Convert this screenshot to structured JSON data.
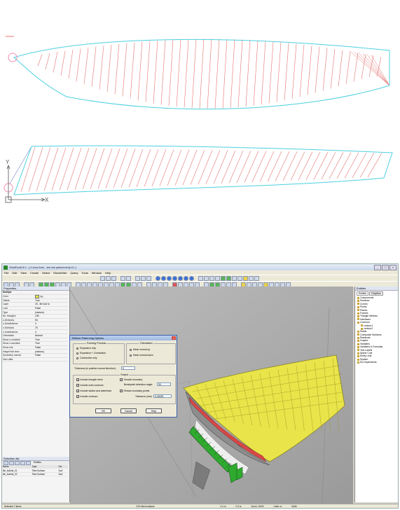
{
  "axes": {
    "y_label": "Y",
    "x_label": "X"
  },
  "app": {
    "title": "ShelfDraft 8.0 - [ Z-bow.3dm - tee tab pattern/ship:01 ]",
    "window_buttons": [
      "_",
      "□",
      "×"
    ],
    "menu": [
      "File",
      "Edit",
      "View",
      "Create",
      "Select",
      "Show/Hide",
      "Query",
      "Tools",
      "Window",
      "Help"
    ],
    "left_panel_title": "Properties",
    "properties": [
      [
        "Multiple",
        ""
      ],
      [
        "Color",
        "Yel"
      ],
      [
        "Visible",
        "True"
      ],
      [
        "Layer",
        "25 - tile tool to"
      ],
      [
        "Lock",
        "False"
      ],
      [
        "Type",
        "(various)"
      ],
      [
        "No. triangles",
        "136"
      ],
      [
        "u-Divisions",
        "54"
      ],
      [
        "u-Subdivisions",
        "4"
      ],
      [
        "v-Divisions",
        "76"
      ],
      [
        "v-Subdivisions",
        "4"
      ],
      [
        "Orientation",
        "Normal"
      ],
      [
        "Show u-constant",
        "True"
      ],
      [
        "Show v-constant",
        "True"
      ],
      [
        "Show rule",
        "False"
      ],
      [
        "Insight fold view",
        "(various)"
      ],
      [
        "Symmetry normal",
        "False"
      ],
      [
        "User data",
        ""
      ]
    ],
    "selection_title": "Selection list",
    "selection_tab": "Entities",
    "selection_columns": [
      "Name",
      "Type",
      "Ow"
    ],
    "selection_rows": [
      [
        "tile_bulkhd_01",
        "Tiled Surface",
        "Surf"
      ],
      [
        "tile_bulkhd_02",
        "Tiled Surface",
        "Surf"
      ]
    ],
    "right_tabs": [
      "Entities",
      "Graphics"
    ],
    "tree": [
      "Components",
      "Surfaces",
      "Curves",
      "Points",
      "Planes",
      "Frames",
      "Triangle Meshes",
      "Interfaces",
      "Contours",
      "contour1",
      "contour2",
      "Solids",
      "Composite Surfaces",
      "Readouts",
      "Graphs",
      "Variables",
      "Variables & Formulas",
      "Text Labels",
      "Spline Cuts",
      "Entity Lists",
      "System",
      "No Dependents"
    ],
    "status": [
      "Selected: 2 items",
      "21%  tiled surfaces",
      "0.4 m",
      "0.3 m",
      "Zoom: 100%",
      "Units: m",
      "NUM"
    ],
    "colors": {
      "accent": "#3a6fd8",
      "surface_yellow": "#e8e44a",
      "stiffener_green": "#2faa2f",
      "rule_red": "#e04444"
    }
  },
  "dialog": {
    "title": "TriMesh Patterning Options",
    "close": "×",
    "forming_title": "Forming Process",
    "forming_options": [
      "Expansion only",
      "Expansion + Contraction",
      "Contraction only"
    ],
    "forming_selected": 1,
    "orientation_title": "Orientation",
    "orientation_options": [
      "Mesh normal up",
      "Mesh normal down"
    ],
    "orientation_selected": 0,
    "thickness_label": "Thickness (in positive normal direction):",
    "thickness_value": "0",
    "output_title": "Output",
    "output_left": [
      "Include triangle mesh",
      "Include main contours",
      "Include station and waterlines",
      "Include contours"
    ],
    "output_left_checked": [
      true,
      true,
      true,
      true
    ],
    "smooth_label": "Smooth boundary",
    "breakpoint_label": "Breakpoint detection angle:",
    "breakpoint_value": "30",
    "reduce_label": "Reduce boundary points",
    "tolerance_label": "Tolerance (mm):",
    "tolerance_value": "0.00025",
    "ok": "OK",
    "cancel": "Cancel",
    "help": "Help"
  }
}
